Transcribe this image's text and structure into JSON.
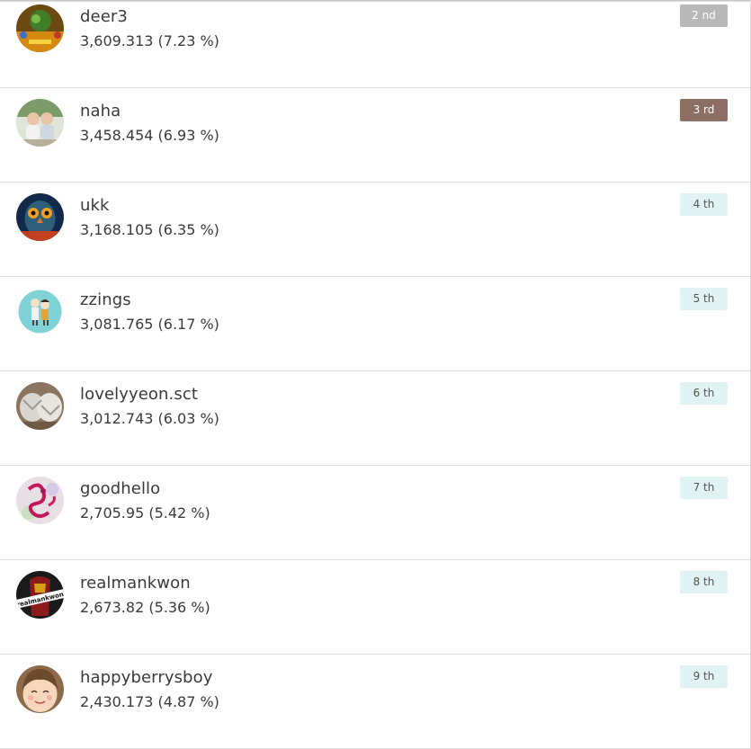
{
  "leaderboard": [
    {
      "name": "deer3",
      "score": "3,609.313 (7.23 %)",
      "rank": "2 nd",
      "badge_style": "silver",
      "avatar": "game-art-avatar"
    },
    {
      "name": "naha",
      "score": "3,458.454 (6.93 %)",
      "rank": "3 rd",
      "badge_style": "bronze",
      "avatar": "children-photo-avatar"
    },
    {
      "name": "ukk",
      "score": "3,168.105 (6.35 %)",
      "rank": "4 th",
      "badge_style": "light",
      "avatar": "owl-art-avatar"
    },
    {
      "name": "zzings",
      "score": "3,081.765 (6.17 %)",
      "rank": "5 th",
      "badge_style": "light",
      "avatar": "cartoon-couple-avatar"
    },
    {
      "name": "lovelyyeon.sct",
      "score": "3,012.743 (6.03 %)",
      "rank": "6 th",
      "badge_style": "light",
      "avatar": "cat-photo-avatar"
    },
    {
      "name": "goodhello",
      "score": "2,705.95 (5.42 %)",
      "rank": "7 th",
      "badge_style": "light",
      "avatar": "dragon-art-avatar"
    },
    {
      "name": "realmankwon",
      "score": "2,673.82 (5.36 %)",
      "rank": "8 th",
      "badge_style": "light",
      "avatar": "ironman-avatar"
    },
    {
      "name": "happyberrysboy",
      "score": "2,430.173 (4.87 %)",
      "rank": "9 th",
      "badge_style": "light",
      "avatar": "smiling-face-avatar"
    }
  ],
  "colors": {
    "silver": "#b8b8b8",
    "bronze": "#8d6e63",
    "light": "#e0f2f1"
  },
  "avatar_text": {
    "ironman": "realmankwon"
  }
}
